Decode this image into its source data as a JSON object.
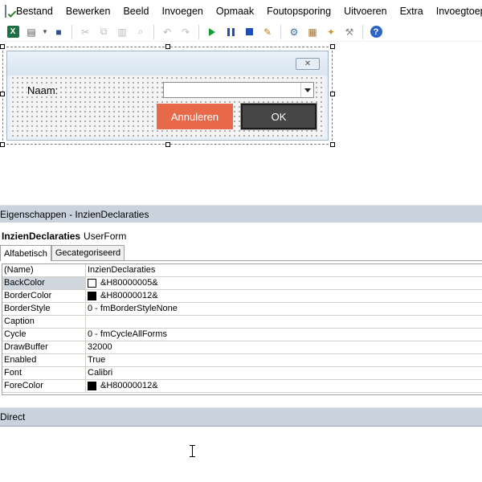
{
  "menu": {
    "items": [
      {
        "label": "Bestand",
        "name": "menu-bestand"
      },
      {
        "label": "Bewerken",
        "name": "menu-bewerken"
      },
      {
        "label": "Beeld",
        "name": "menu-beeld"
      },
      {
        "label": "Invoegen",
        "name": "menu-invoegen"
      },
      {
        "label": "Opmaak",
        "name": "menu-opmaak"
      },
      {
        "label": "Foutopsporing",
        "name": "menu-foutopsporing"
      },
      {
        "label": "Uitvoeren",
        "name": "menu-uitvoeren"
      },
      {
        "label": "Extra",
        "name": "menu-extra"
      },
      {
        "label": "Invoegtoepassingen",
        "name": "menu-invoegtoepassingen"
      }
    ]
  },
  "toolbar": {
    "icons": [
      "excel-icon",
      "insert-userform-icon",
      "save-icon",
      "cut-icon",
      "copy-icon",
      "paste-icon",
      "find-icon",
      "undo-icon",
      "redo-icon",
      "run-icon",
      "break-icon",
      "reset-icon",
      "design-mode-icon",
      "project-explorer-icon",
      "properties-window-icon",
      "object-browser-icon",
      "toolbox-icon",
      "help-icon"
    ]
  },
  "userform": {
    "close_glyph": "✕",
    "naam_label": "Naam:",
    "naam_value": "",
    "cancel_label": "Annuleren",
    "ok_label": "OK",
    "cancel_color": "#e8684a",
    "ok_color": "#464646"
  },
  "properties": {
    "title": "Eigenschappen - InzienDeclaraties",
    "object_name": "InzienDeclaraties",
    "object_type": "UserForm",
    "tabs": [
      {
        "label": "Alfabetisch",
        "active": true
      },
      {
        "label": "Gecategoriseerd",
        "active": false
      }
    ],
    "rows": [
      {
        "name": "(Name)",
        "value": "InzienDeclaraties",
        "swatch": null
      },
      {
        "name": "BackColor",
        "value": "&H80000005&",
        "swatch": "#ffffff"
      },
      {
        "name": "BorderColor",
        "value": "&H80000012&",
        "swatch": "#000000"
      },
      {
        "name": "BorderStyle",
        "value": "0 - fmBorderStyleNone",
        "swatch": null
      },
      {
        "name": "Caption",
        "value": "",
        "swatch": null
      },
      {
        "name": "Cycle",
        "value": "0 - fmCycleAllForms",
        "swatch": null
      },
      {
        "name": "DrawBuffer",
        "value": "32000",
        "swatch": null
      },
      {
        "name": "Enabled",
        "value": "True",
        "swatch": null
      },
      {
        "name": "Font",
        "value": "Calibri",
        "swatch": null
      },
      {
        "name": "ForeColor",
        "value": "&H80000012&",
        "swatch": "#000000"
      }
    ]
  },
  "direct": {
    "title": "Direct"
  }
}
